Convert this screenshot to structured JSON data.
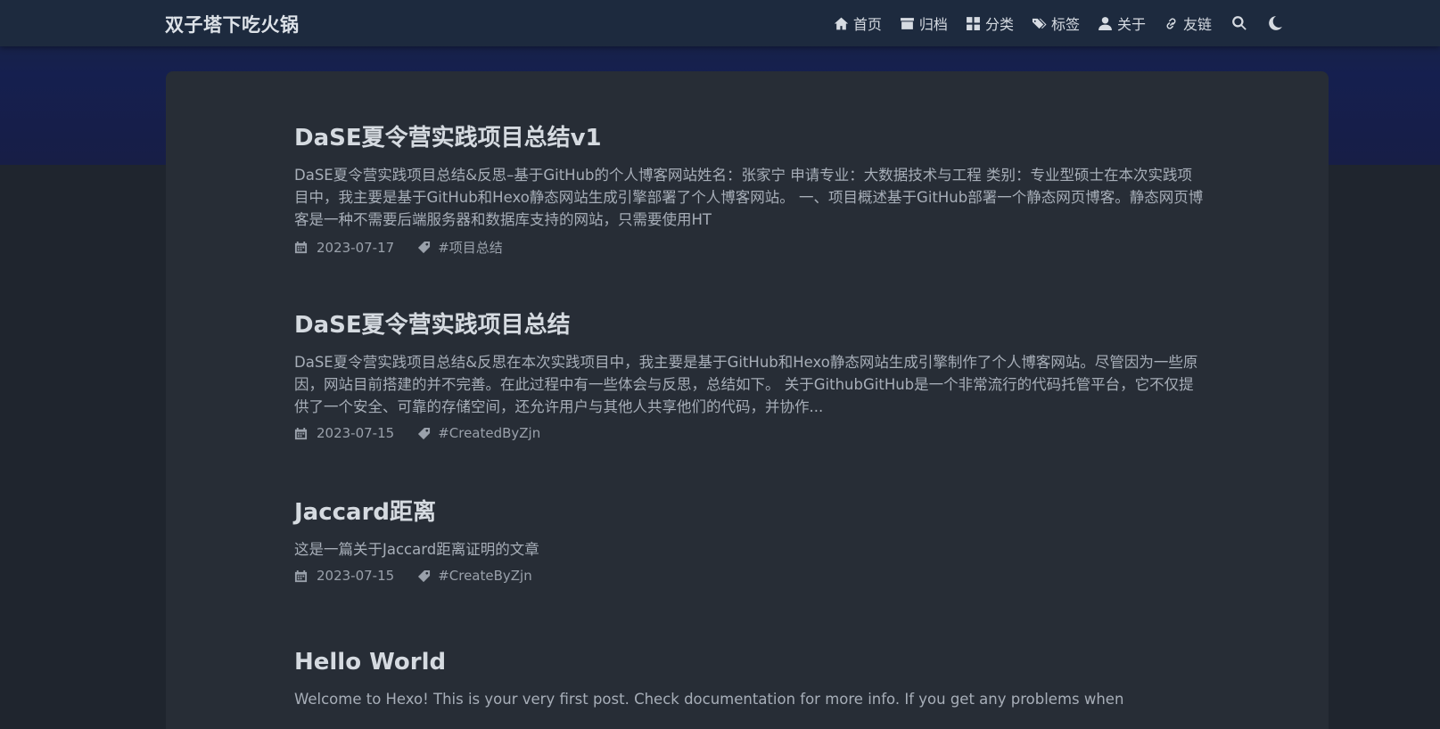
{
  "site": {
    "title": "双子塔下吃火锅"
  },
  "nav": {
    "items": [
      {
        "label": "首页",
        "icon": "home-icon"
      },
      {
        "label": "归档",
        "icon": "archive-icon"
      },
      {
        "label": "分类",
        "icon": "grid-icon"
      },
      {
        "label": "标签",
        "icon": "tags-icon"
      },
      {
        "label": "关于",
        "icon": "user-icon"
      },
      {
        "label": "友链",
        "icon": "link-icon"
      }
    ],
    "search_icon": "search-icon",
    "theme_icon": "moon-icon"
  },
  "posts": [
    {
      "title": "DaSE夏令营实践项目总结v1",
      "excerpt": "DaSE夏令营实践项目总结&反思–基于GitHub的个人博客网站姓名：张家宁    申请专业：大数据技术与工程    类别：专业型硕士在本次实践项目中，我主要是基于GitHub和Hexo静态网站生成引擎部署了个人博客网站。 一、项目概述基于GitHub部署一个静态网页博客。静态网页博客是一种不需要后端服务器和数据库支持的网站，只需要使用HT",
      "date": "2023-07-17",
      "tag": "#项目总结"
    },
    {
      "title": "DaSE夏令营实践项目总结",
      "excerpt": "DaSE夏令营实践项目总结&反思在本次实践项目中，我主要是基于GitHub和Hexo静态网站生成引擎制作了个人博客网站。尽管因为一些原因，网站目前搭建的并不完善。在此过程中有一些体会与反思，总结如下。 关于GithubGitHub是一个非常流行的代码托管平台，它不仅提供了一个安全、可靠的存储空间，还允许用户与其他人共享他们的代码，并协作...",
      "date": "2023-07-15",
      "tag": "#CreatedByZjn"
    },
    {
      "title": "Jaccard距离",
      "excerpt": "这是一篇关于Jaccard距离证明的文章",
      "date": "2023-07-15",
      "tag": "#CreateByZjn"
    },
    {
      "title": "Hello World",
      "excerpt": "Welcome to Hexo! This is your very first post. Check documentation for more info. If you get any problems when",
      "date": "",
      "tag": ""
    }
  ],
  "colors": {
    "navbar": "#1d2a3e",
    "banner": "#151f4f",
    "background": "#1f252e",
    "card": "#272d36",
    "title_text": "#d5dae0",
    "body_text": "#a7aeb8"
  },
  "icons": {
    "date": "calendar-icon",
    "tag": "tag-icon"
  }
}
